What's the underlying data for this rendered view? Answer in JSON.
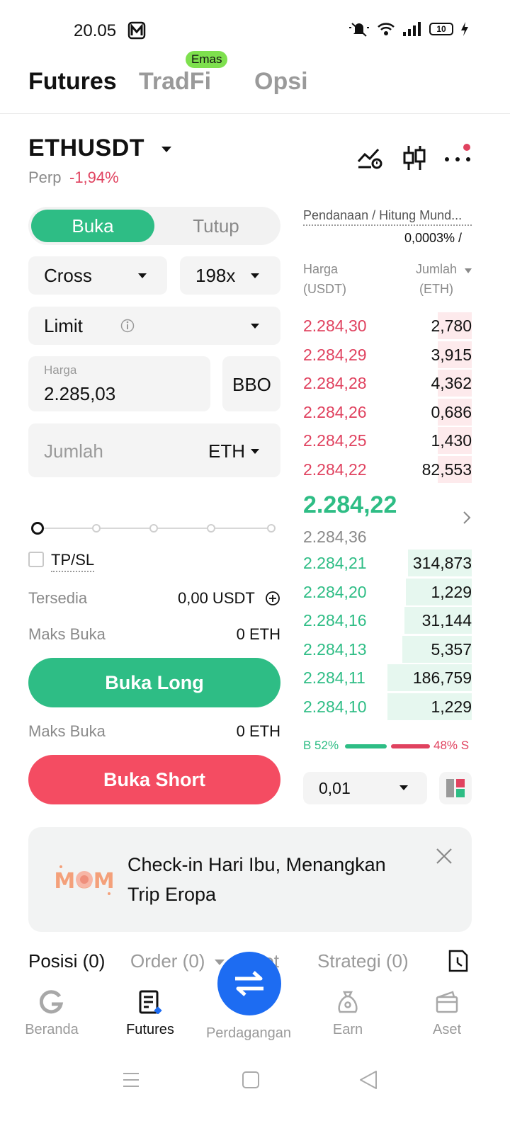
{
  "status_bar": {
    "time": "20.05",
    "battery": "10"
  },
  "top_tabs": {
    "futures": "Futures",
    "tradfi": "TradFi",
    "opsi": "Opsi",
    "emas_badge": "Emas"
  },
  "pair": {
    "symbol": "ETHUSDT",
    "type": "Perp",
    "change": "-1,94%"
  },
  "form": {
    "open_label": "Buka",
    "close_label": "Tutup",
    "margin_mode": "Cross",
    "leverage": "198x",
    "order_type": "Limit",
    "price_label": "Harga",
    "price_value": "2.285,03",
    "bbo_label": "BBO",
    "amount_placeholder": "Jumlah",
    "amount_unit": "ETH",
    "tpsl_label": "TP/SL",
    "available_label": "Tersedia",
    "available_value": "0,00 USDT",
    "max_open_label": "Maks Buka",
    "max_open_long_value": "0 ETH",
    "max_open_short_value": "0 ETH",
    "long_button": "Buka Long",
    "short_button": "Buka Short"
  },
  "order_book": {
    "funding_label": "Pendanaan / Hitung Mund...",
    "funding_value": "0,0003% /",
    "price_header": "Harga",
    "price_unit": "(USDT)",
    "qty_header": "Jumlah",
    "qty_unit": "(ETH)",
    "asks": [
      {
        "price": "2.284,30",
        "qty": "2,780",
        "depth": 0.2
      },
      {
        "price": "2.284,29",
        "qty": "3,915",
        "depth": 0.2
      },
      {
        "price": "2.284,28",
        "qty": "4,362",
        "depth": 0.2
      },
      {
        "price": "2.284,26",
        "qty": "0,686",
        "depth": 0.2
      },
      {
        "price": "2.284,25",
        "qty": "1,430",
        "depth": 0.2
      },
      {
        "price": "2.284,22",
        "qty": "82,553",
        "depth": 0.2
      }
    ],
    "last_price": "2.284,22",
    "mark_price": "2.284,36",
    "bids": [
      {
        "price": "2.284,21",
        "qty": "314,873",
        "depth": 0.38
      },
      {
        "price": "2.284,20",
        "qty": "1,229",
        "depth": 0.39
      },
      {
        "price": "2.284,16",
        "qty": "31,144",
        "depth": 0.4
      },
      {
        "price": "2.284,13",
        "qty": "5,357",
        "depth": 0.41
      },
      {
        "price": "2.284,11",
        "qty": "186,759",
        "depth": 0.5
      },
      {
        "price": "2.284,10",
        "qty": "1,229",
        "depth": 0.5
      }
    ],
    "buy_ratio": "B 52%",
    "sell_ratio": "48% S",
    "buy_share": 0.52,
    "tick_size": "0,01"
  },
  "banner": {
    "text": "Check-in Hari Ibu, Menangkan Trip Eropa",
    "logo_text": "MOM"
  },
  "position_tabs": {
    "posisi": "Posisi (0)",
    "order": "Order (0)",
    "aset": "Aset",
    "strategi": "Strategi (0)"
  },
  "nav": {
    "beranda": "Beranda",
    "futures": "Futures",
    "perdagangan": "Perdagangan",
    "earn": "Earn",
    "aset": "Aset"
  },
  "colors": {
    "green": "#2ebd85",
    "red": "#e0425f",
    "blue": "#1d6cf2",
    "emas": "#7ee04e"
  }
}
